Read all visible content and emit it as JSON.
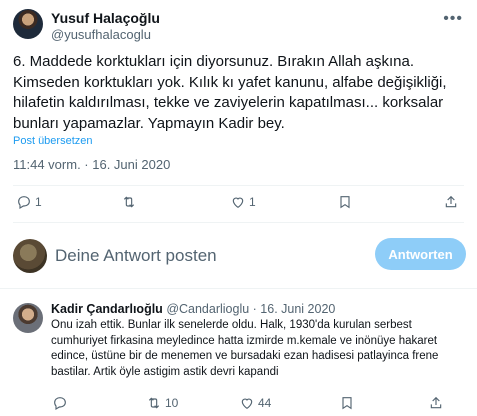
{
  "tweet": {
    "author_name": "Yusuf Halaçoğlu",
    "author_handle": "@yusufhalacoglu",
    "text": "6. Maddede korktukları için diyorsunuz. Bırakın Allah aşkına. Kimseden korktukları yok. Kılık kı yafet kanunu, alfabe değişikliği, hilafetin kaldırılması, tekke ve zaviyelerin kapatılması... korksalar bunları yapamazlar. Yapmayın Kadir bey.",
    "translate_label": "Post übersetzen",
    "timestamp": "11:44 vorm. · 16. Juni 2020",
    "stats": {
      "replies": "1",
      "retweets": "",
      "likes": "1"
    }
  },
  "compose": {
    "placeholder": "Deine Antwort posten",
    "button_label": "Antworten"
  },
  "reply": {
    "author_name": "Kadir Çandarlıoğlu",
    "author_handle": "@Candarlioglu",
    "separator": " · ",
    "date": "16. Juni 2020",
    "text": "Onu izah ettik. Bunlar ilk senelerde oldu. Halk, 1930'da kurulan serbest cumhuriyet firkasina meyledince hatta izmirde m.kemale ve inönüye hakaret edince, üstüne bir de menemen ve bursadaki ezan hadisesi patlayinca frene bastilar. Artik öyle astigim astik devri kapandi",
    "stats": {
      "replies": "",
      "retweets": "10",
      "likes": "44"
    }
  },
  "colors": {
    "accent": "#1d9bf0",
    "button_disabled": "#8ecdf8",
    "secondary_text": "#536471",
    "divider": "#eff3f4"
  },
  "icons": [
    "more-icon",
    "reply-icon",
    "retweet-icon",
    "like-icon",
    "bookmark-icon",
    "share-icon"
  ]
}
